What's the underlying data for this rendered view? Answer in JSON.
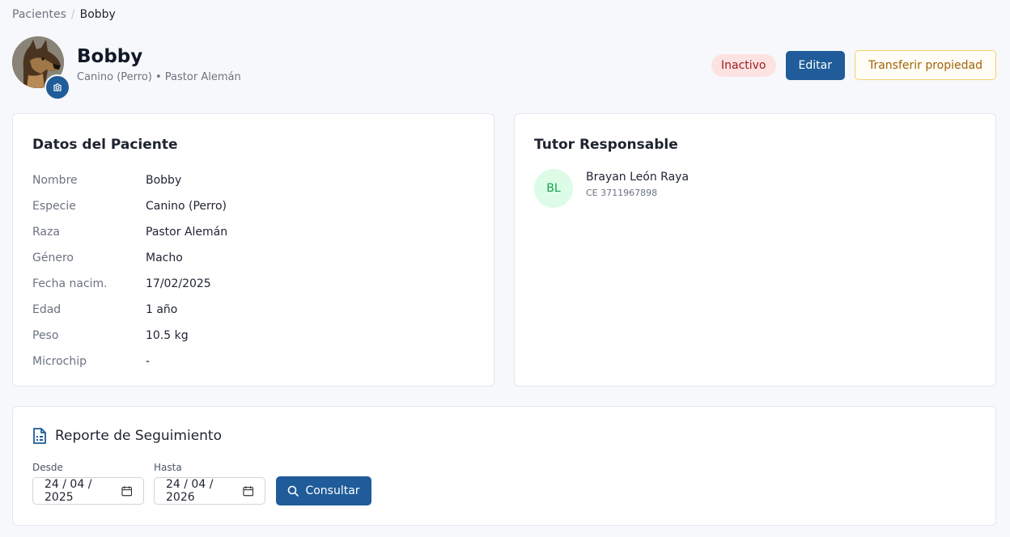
{
  "breadcrumb": {
    "parent": "Pacientes",
    "separator": "/",
    "current": "Bobby"
  },
  "patient_header": {
    "name": "Bobby",
    "subtitle": "Canino (Perro) • Pastor Alemán",
    "status": "Inactivo",
    "edit_label": "Editar",
    "transfer_label": "Transferir propiedad"
  },
  "patient_card": {
    "title": "Datos del Paciente",
    "rows": [
      {
        "label": "Nombre",
        "value": "Bobby"
      },
      {
        "label": "Especie",
        "value": "Canino (Perro)"
      },
      {
        "label": "Raza",
        "value": "Pastor Alemán"
      },
      {
        "label": "Género",
        "value": "Macho"
      },
      {
        "label": "Fecha nacim.",
        "value": "17/02/2025"
      },
      {
        "label": "Edad",
        "value": "1 año"
      },
      {
        "label": "Peso",
        "value": "10.5 kg"
      },
      {
        "label": "Microchip",
        "value": "-"
      }
    ]
  },
  "tutor_card": {
    "title": "Tutor Responsable",
    "initials": "BL",
    "name": "Brayan León Raya",
    "document": "CE 3711967898"
  },
  "report": {
    "title": "Reporte de Seguimiento",
    "from_label": "Desde",
    "from_value": "24 / 04 / 2025",
    "to_label": "Hasta",
    "to_value": "24 / 04 / 2026",
    "consult_label": "Consultar"
  },
  "colors": {
    "primary": "#1f5c99",
    "inactive_bg": "#fde2e2",
    "inactive_text": "#9b1c1c",
    "warning": "#a16207",
    "tutor_avatar_bg": "#dcfce7",
    "tutor_avatar_text": "#16a34a"
  },
  "icons": {
    "camera": "camera-icon",
    "report": "document-report-icon",
    "calendar": "calendar-icon",
    "search": "search-icon"
  }
}
